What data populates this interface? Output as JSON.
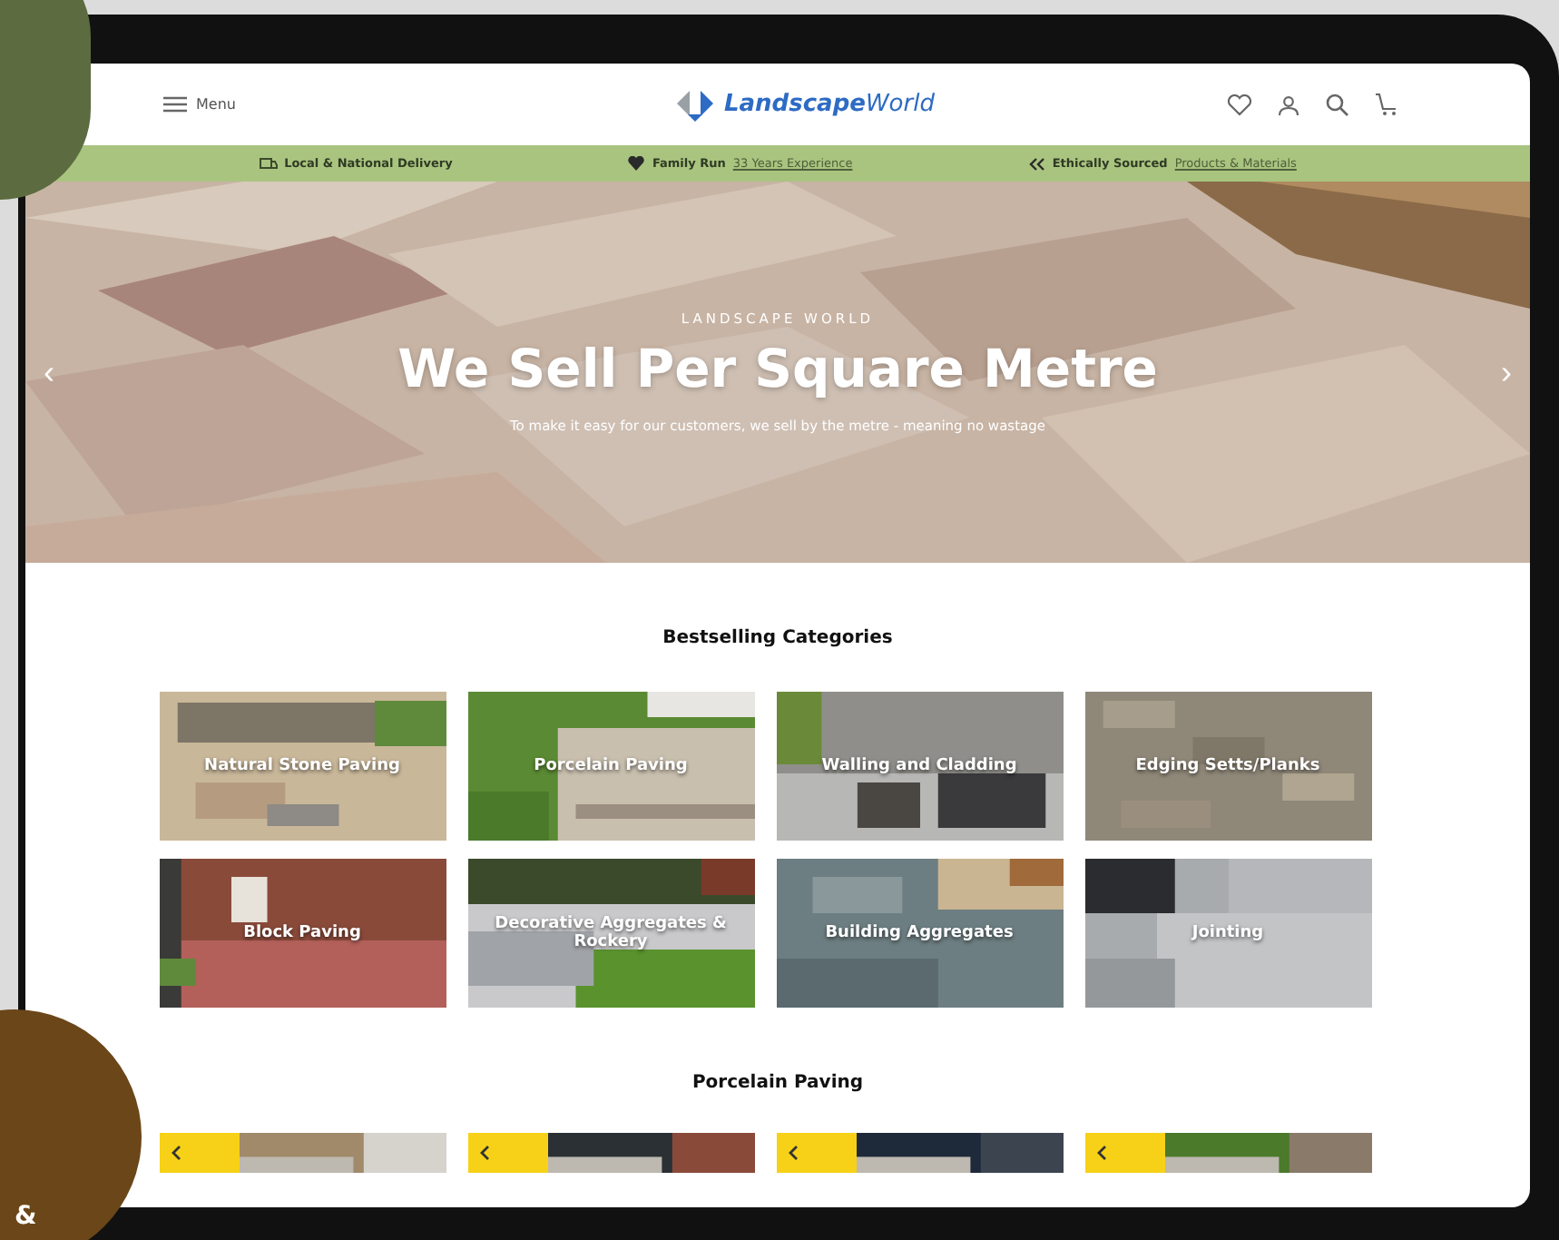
{
  "header": {
    "menu_label": "Menu",
    "logo": "**Landscape**World"
  },
  "usp_bar": [
    {
      "kind": "delivery",
      "text": "Local & National Delivery"
    },
    {
      "kind": "family",
      "text": "Family Run",
      "link": "33 Years Experience"
    },
    {
      "kind": "ethical",
      "text": "Ethically Sourced",
      "link": "Products & Materials"
    }
  ],
  "hero": {
    "prev": "‹",
    "next": "›",
    "eyebrow": "LANDSCAPE WORLD",
    "title": "We Sell Per Square Metre",
    "subtitle": "To make it easy for our customers, we sell by the metre - meaning no wastage"
  },
  "bestselling": {
    "heading": "Bestselling Categories",
    "categories": [
      {
        "name": "Natural Stone Paving"
      },
      {
        "name": "Porcelain Paving"
      },
      {
        "name": "Walling and Cladding"
      },
      {
        "name": "Edging Setts/Planks"
      },
      {
        "name": "Block Paving"
      },
      {
        "name": "Decorative Aggregates & Rockery"
      },
      {
        "name": "Building Aggregates"
      },
      {
        "name": "Jointing"
      }
    ]
  },
  "porcelain": {
    "heading": "Porcelain Paving"
  },
  "decor": {
    "mark": "&"
  }
}
